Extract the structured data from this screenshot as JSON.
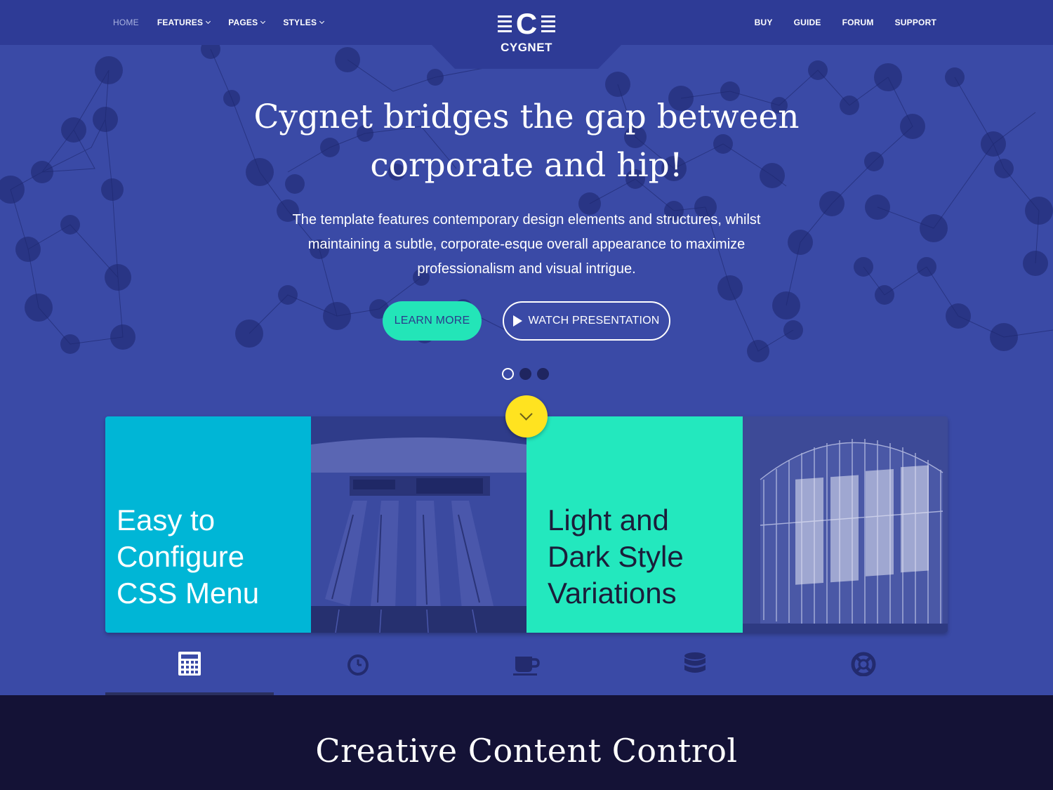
{
  "nav": {
    "left": [
      {
        "label": "HOME",
        "dropdown": false,
        "active": true
      },
      {
        "label": "FEATURES",
        "dropdown": true
      },
      {
        "label": "PAGES",
        "dropdown": true
      },
      {
        "label": "STYLES",
        "dropdown": true
      }
    ],
    "right": [
      {
        "label": "BUY"
      },
      {
        "label": "GUIDE"
      },
      {
        "label": "FORUM"
      },
      {
        "label": "SUPPORT"
      }
    ],
    "logo_letter": "C",
    "logo_text": "CYGNET"
  },
  "hero": {
    "title": "Cygnet bridges the gap between corporate and hip!",
    "subtitle": "The template features contemporary design elements and structures, whilst maintaining a subtle, corporate-esque overall appearance to maximize professionalism and visual intrigue.",
    "learn_more": "LEARN MORE",
    "watch": "WATCH PRESENTATION",
    "slides": 3,
    "active_slide": 1
  },
  "features": {
    "tile1": "Easy to Configure CSS Menu",
    "tile2": "Light and Dark Style Variations"
  },
  "icon_tabs": [
    {
      "icon": "calculator-icon",
      "active": true
    },
    {
      "icon": "clock-icon",
      "active": false
    },
    {
      "icon": "coffee-cup-icon",
      "active": false
    },
    {
      "icon": "database-icon",
      "active": false
    },
    {
      "icon": "life-ring-icon",
      "active": false
    }
  ],
  "colors": {
    "hero_bg": "#3a4aa6",
    "nav_bg": "#2e3b96",
    "accent_mint": "#23e5b8",
    "accent_cyan": "#00b6d6",
    "accent_yellow": "#ffe320",
    "footer_bg": "#141236"
  },
  "section": {
    "heading": "Creative Content Control"
  }
}
